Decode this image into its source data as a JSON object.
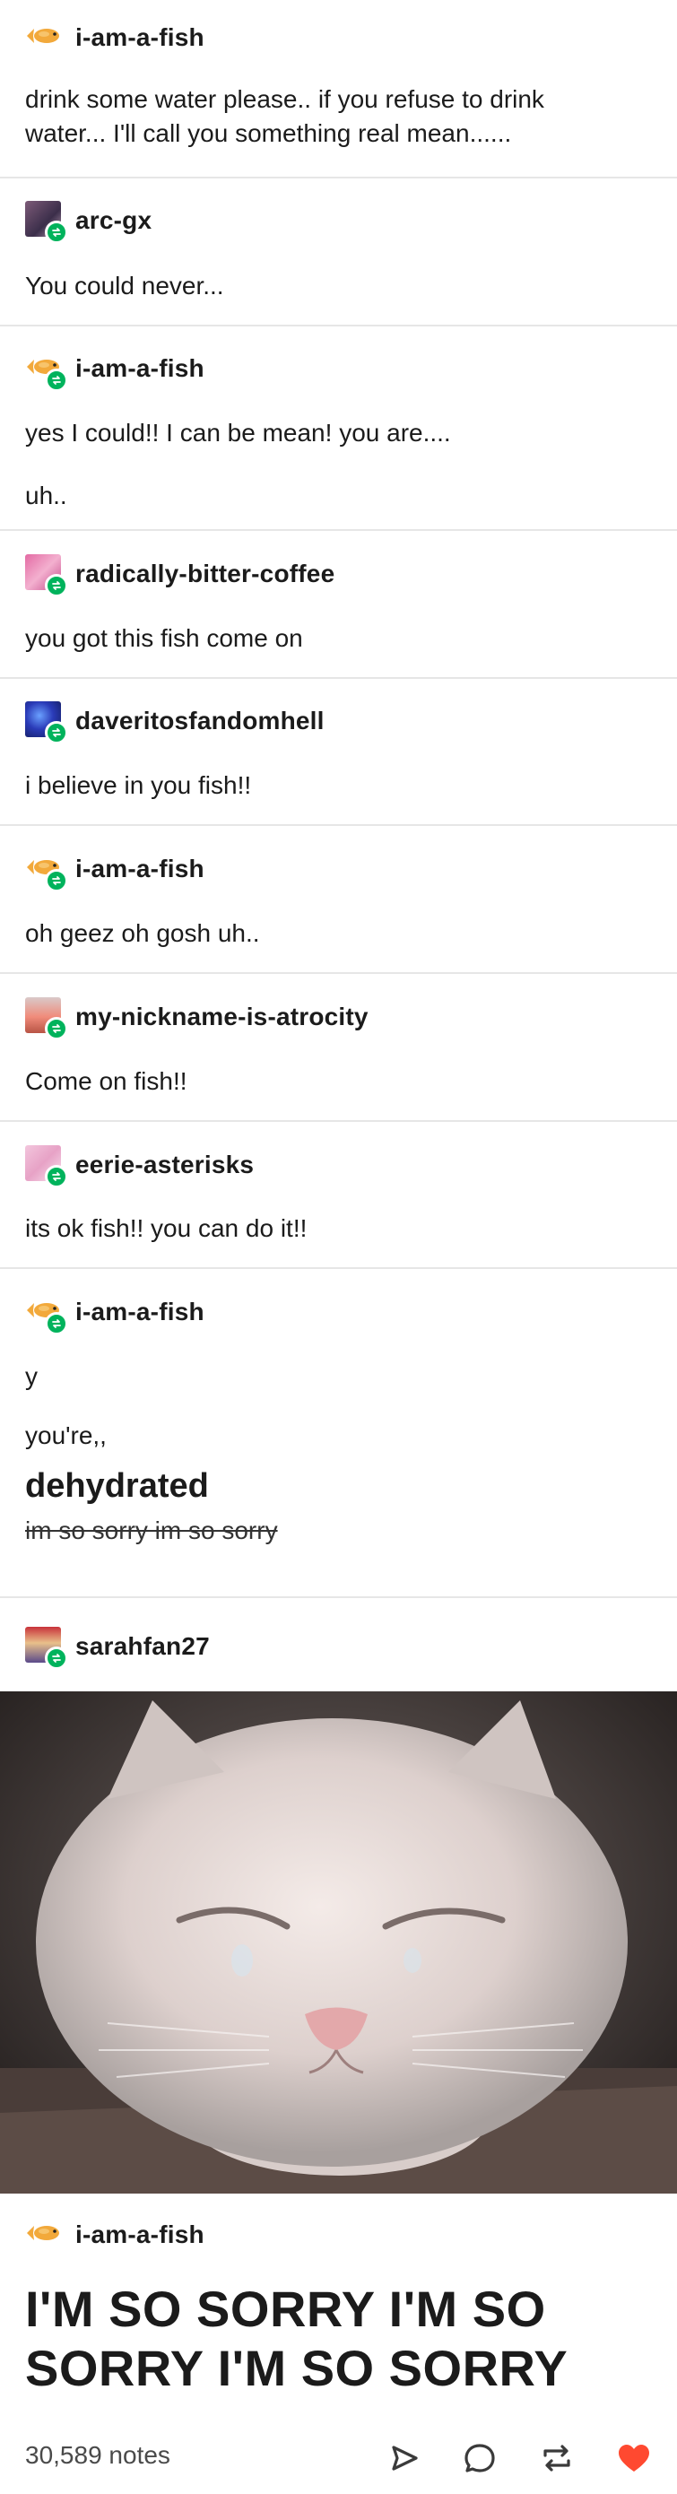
{
  "posts": [
    {
      "username": "i-am-a-fish",
      "lines": [
        "drink some water please.. if you refuse to drink",
        "water... I'll call you something real mean......"
      ]
    },
    {
      "username": "arc-gx",
      "lines": [
        "You could never..."
      ]
    },
    {
      "username": "i-am-a-fish",
      "lines": [
        "yes I could!! I can be mean! you are....",
        "uh.."
      ]
    },
    {
      "username": "radically-bitter-coffee",
      "lines": [
        "you got this fish come on"
      ]
    },
    {
      "username": "daveritosfandomhell",
      "lines": [
        "i believe in you fish!!"
      ]
    },
    {
      "username": "i-am-a-fish",
      "lines": [
        "oh geez oh gosh uh.."
      ]
    },
    {
      "username": "my-nickname-is-atrocity",
      "lines": [
        "Come on fish!!"
      ]
    },
    {
      "username": "eerie-asterisks",
      "lines": [
        "its ok fish!! you can do it!!"
      ]
    },
    {
      "username": "i-am-a-fish",
      "lines": [
        "y",
        "you're,,"
      ],
      "emphasis": "dehydrated",
      "strikethrough": "im so sorry im so sorry"
    },
    {
      "username": "sarahfan27",
      "image": "crying-white-cat-photo"
    },
    {
      "username": "i-am-a-fish",
      "shout_lines": [
        "I'M SO SORRY I'M SO",
        "SORRY I'M SO SORRY"
      ]
    }
  ],
  "footer": {
    "notes": "30,589 notes",
    "actions": [
      "share-icon",
      "reply-icon",
      "reblog-icon",
      "like-icon"
    ]
  },
  "colors": {
    "reblog_badge": "#00b35c",
    "like": "#ff4930",
    "divider": "#e6e6e6"
  }
}
